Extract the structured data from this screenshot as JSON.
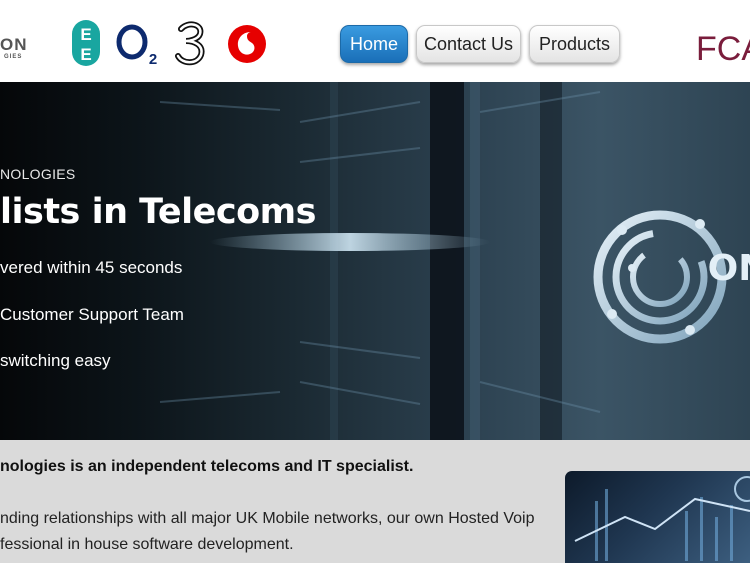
{
  "header": {
    "brand": {
      "line1": "ON",
      "line2": "GIES"
    },
    "carriers": [
      "ee-logo-icon",
      "o2-logo-icon",
      "three-logo-icon",
      "vodafone-logo-icon"
    ],
    "nav": {
      "home": "Home",
      "contact": "Contact Us",
      "products": "Products"
    },
    "badge": {
      "text": "FCA"
    },
    "colors": {
      "active": "#1a6fb8",
      "ee": "#19a6a0",
      "o2": "#0d2a6e",
      "vodafone": "#e60000",
      "fca": "#7a1d3c"
    }
  },
  "hero": {
    "eyebrow": "NOLOGIES",
    "title": "lists in Telecoms",
    "points": [
      "vered within 45 seconds",
      "Customer Support Team",
      "switching easy"
    ],
    "emblem_text": "ON"
  },
  "about": {
    "heading": "nologies is an independent telecoms and IT specialist.",
    "lines": [
      "nding relationships with all major UK Mobile networks, our own Hosted Voip",
      "fessional in house software development."
    ]
  }
}
